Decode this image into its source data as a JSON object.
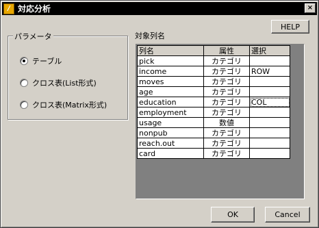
{
  "window": {
    "title": "対応分析",
    "icon": "app-logo-icon",
    "close_label": "×"
  },
  "help_button": "HELP",
  "parameters": {
    "label": "パラメータ",
    "options": [
      {
        "label": "テーブル",
        "checked": true
      },
      {
        "label": "クロス表(List形式)",
        "checked": false
      },
      {
        "label": "クロス表(Matrix形式)",
        "checked": false
      }
    ]
  },
  "columns_list": {
    "label": "対象列名",
    "headers": {
      "name": "列名",
      "attribute": "属性",
      "selection": "選択"
    },
    "rows": [
      {
        "name": "pick",
        "attribute": "カテゴリ",
        "selection": ""
      },
      {
        "name": "income",
        "attribute": "カテゴリ",
        "selection": "ROW"
      },
      {
        "name": "moves",
        "attribute": "カテゴリ",
        "selection": ""
      },
      {
        "name": "age",
        "attribute": "カテゴリ",
        "selection": ""
      },
      {
        "name": "education",
        "attribute": "カテゴリ",
        "selection": "COL"
      },
      {
        "name": "employment",
        "attribute": "カテゴリ",
        "selection": ""
      },
      {
        "name": "usage",
        "attribute": "数値",
        "selection": ""
      },
      {
        "name": "nonpub",
        "attribute": "カテゴリ",
        "selection": ""
      },
      {
        "name": "reach.out",
        "attribute": "カテゴリ",
        "selection": ""
      },
      {
        "name": "card",
        "attribute": "カテゴリ",
        "selection": ""
      }
    ]
  },
  "ok_button": "OK",
  "cancel_button": "Cancel"
}
